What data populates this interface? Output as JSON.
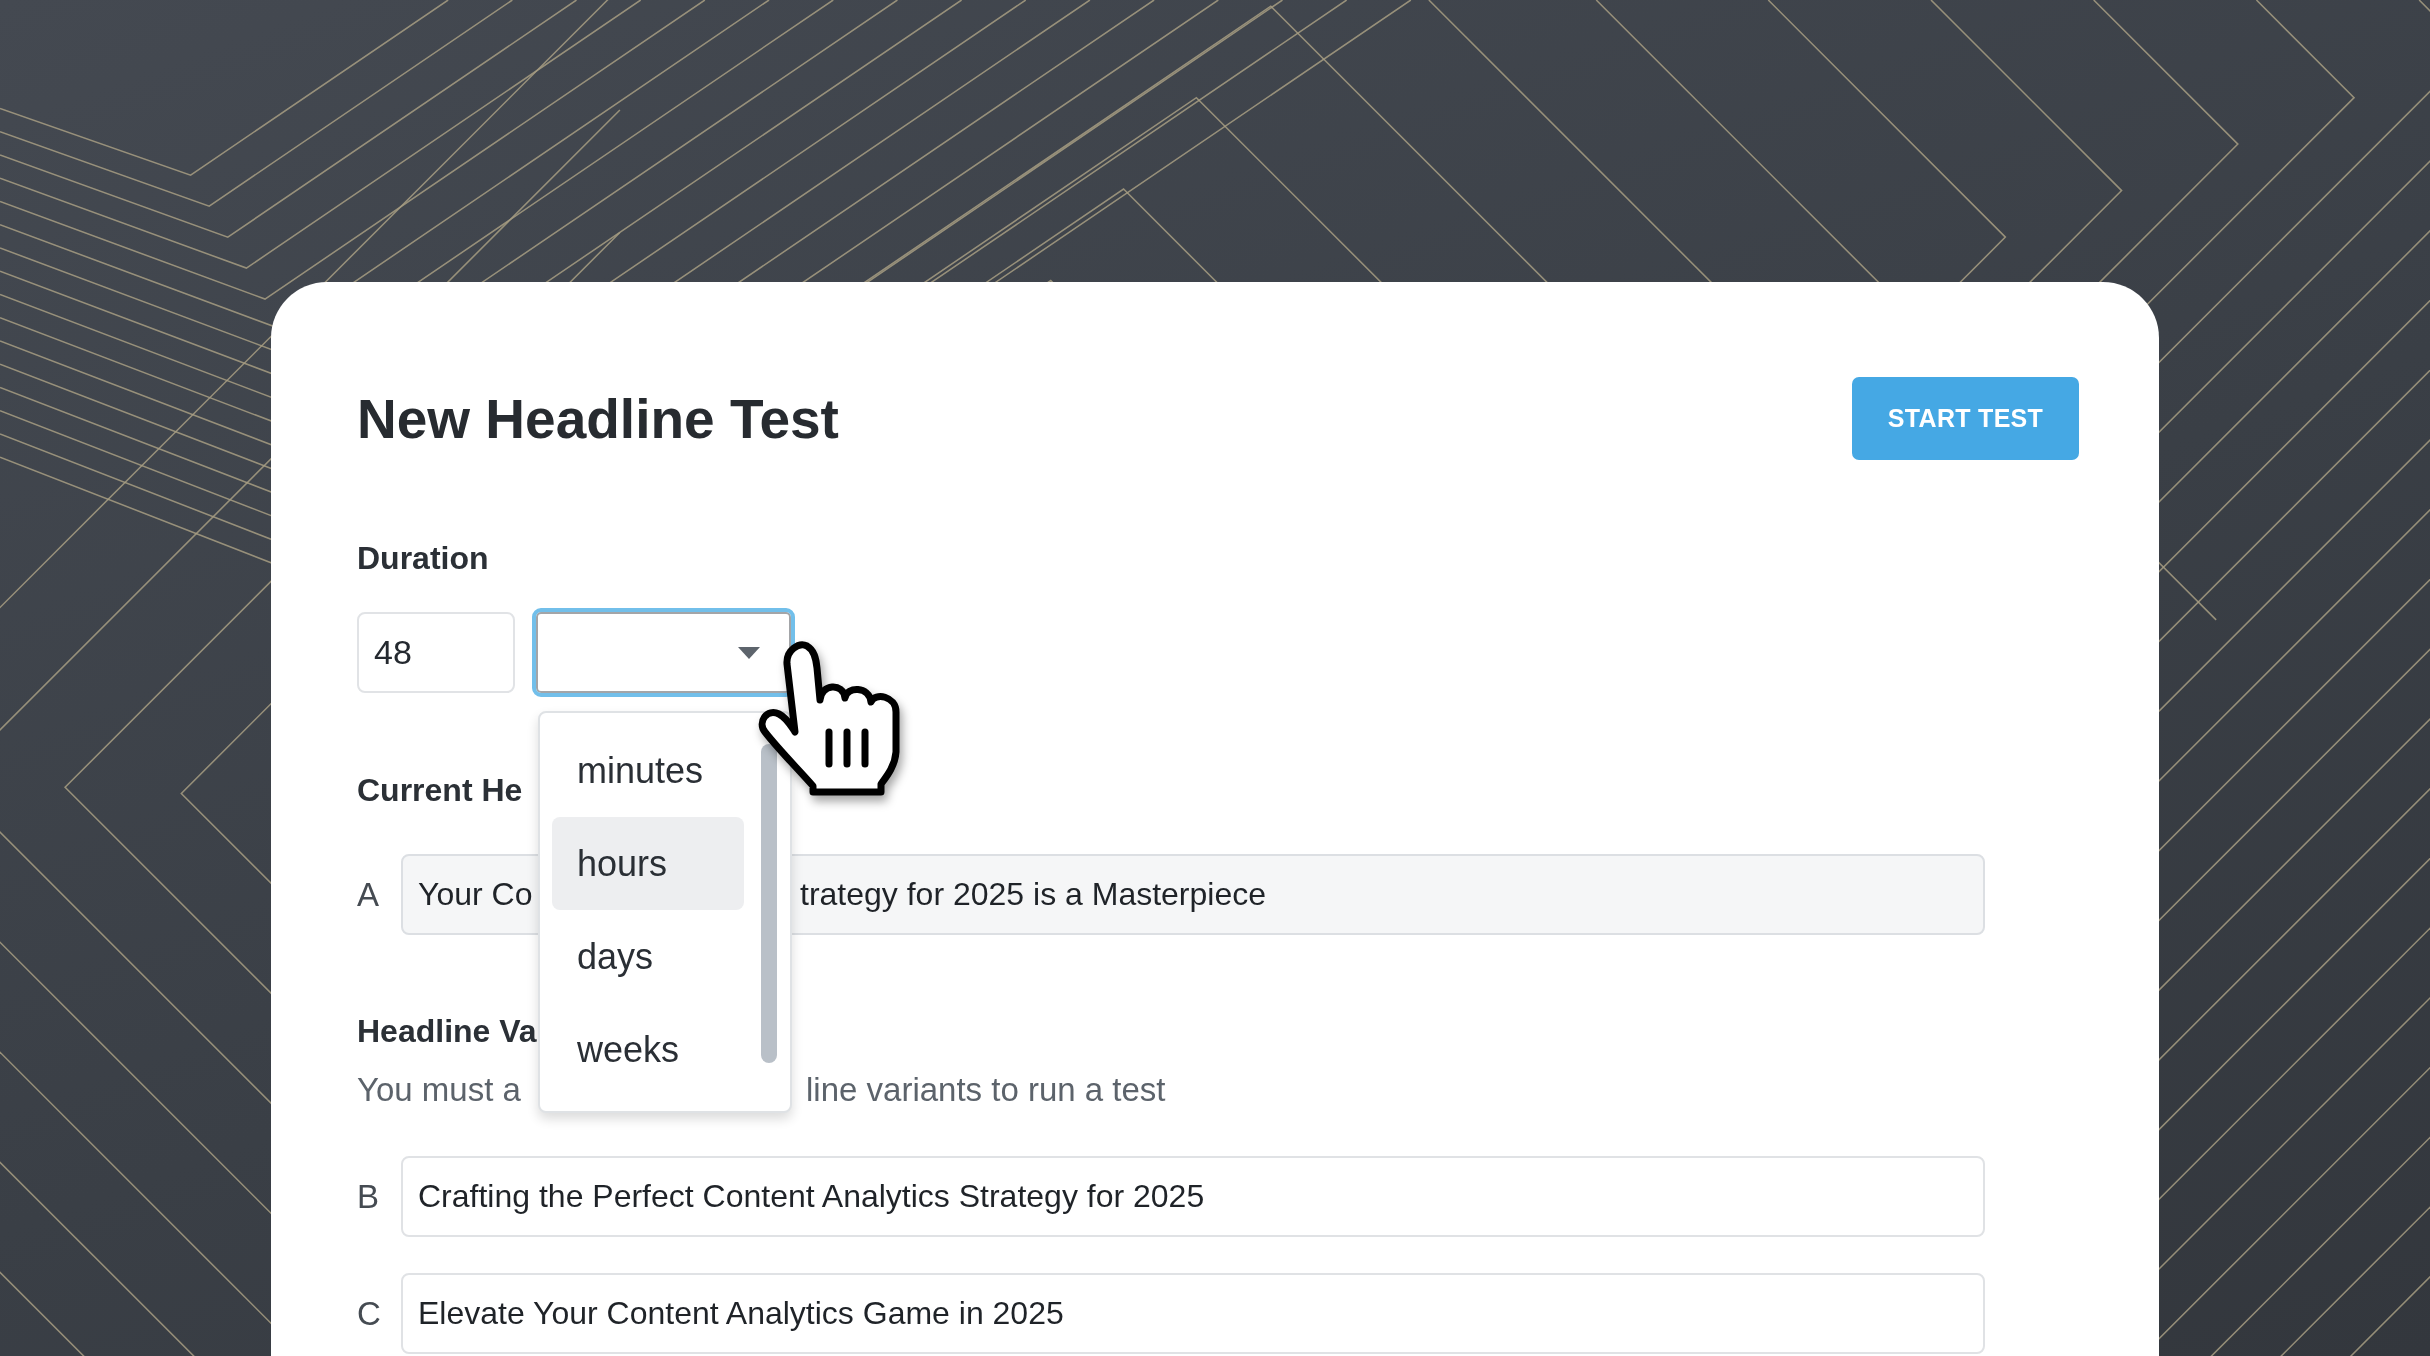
{
  "header": {
    "title": "New Headline Test",
    "start_button": {
      "label": "START TEST"
    }
  },
  "duration": {
    "label": "Duration",
    "value": "48",
    "unit_select": {
      "open": true,
      "options": [
        {
          "label": "minutes",
          "selected": false
        },
        {
          "label": "hours",
          "selected": true
        },
        {
          "label": "days",
          "selected": false
        },
        {
          "label": "weeks",
          "selected": false
        }
      ]
    }
  },
  "current_headline": {
    "label": "Current He",
    "letter": "A",
    "value_left": "Your Co",
    "value_right": "trategy for 2025 is a Masterpiece"
  },
  "headline_variants": {
    "label": "Headline Va",
    "helper_left": "You must a",
    "helper_right": "line variants to run a test",
    "items": [
      {
        "letter": "B",
        "value": "Crafting the Perfect Content Analytics Strategy for 2025"
      },
      {
        "letter": "C",
        "value": "Elevate Your Content Analytics Game in 2025"
      }
    ]
  }
}
